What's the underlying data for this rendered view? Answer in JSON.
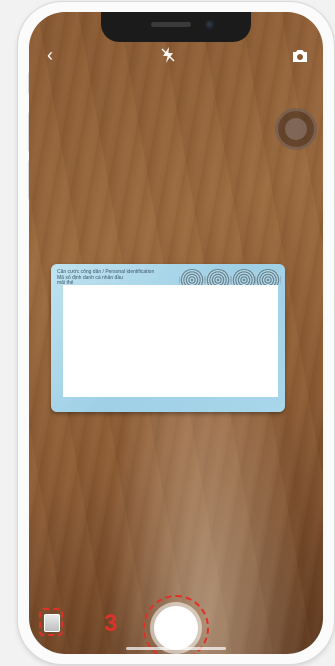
{
  "app": {
    "screen": "camera-capture"
  },
  "top_bar": {
    "back_icon": "chevron-left-icon",
    "back_glyph": "‹",
    "flash_icon": "flash-off-icon",
    "flip_icon": "camera-flip-icon"
  },
  "id_card": {
    "header_lines": [
      "Căn cước công dân / Personal identification",
      "Mã số định danh cá nhân đầu",
      "mãi thẻ"
    ]
  },
  "bottom_bar": {
    "step_label": "3",
    "gallery_icon": "gallery-thumbnail-icon",
    "shutter_icon": "shutter-button-icon"
  },
  "colors": {
    "annotation_red": "#e0302a",
    "card_blue": "#a8d6ea"
  }
}
